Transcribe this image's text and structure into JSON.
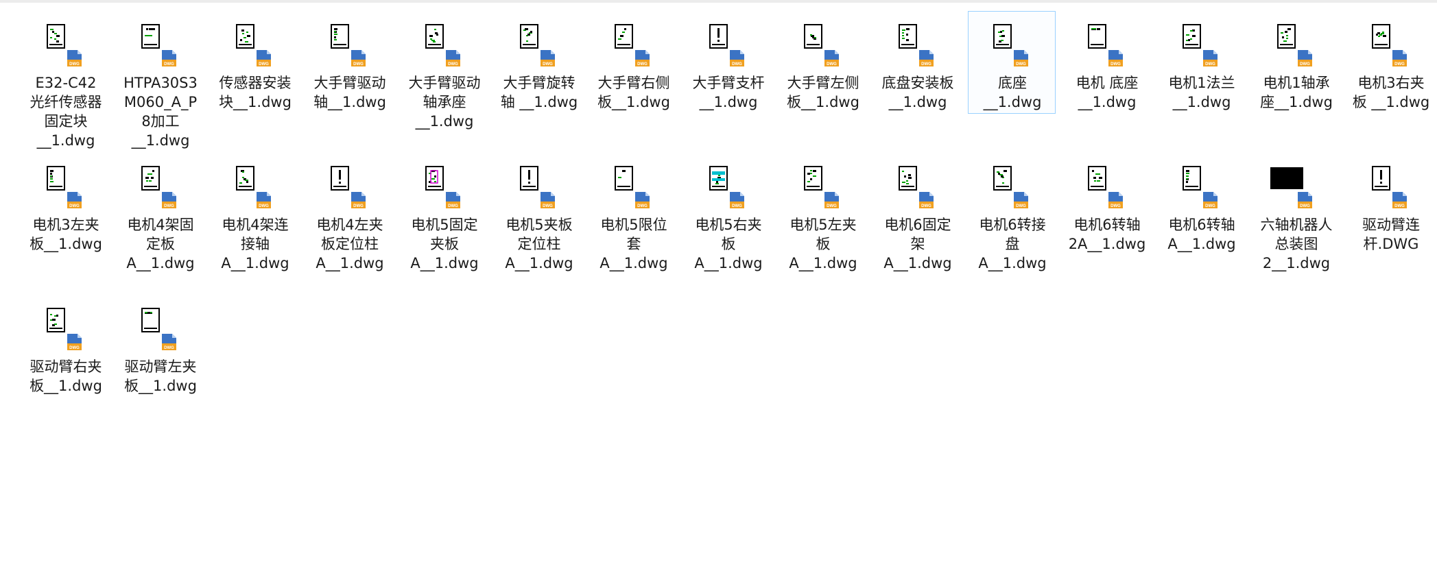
{
  "files": [
    {
      "label": "E32-C42\n光纤传感器\n固定块\n__1.dwg",
      "icon": "dwg-file-icon",
      "thumb": "drawing",
      "selected": false
    },
    {
      "label": "HTPA30S3\nM060_A_P\n8加工\n__1.dwg",
      "icon": "dwg-file-icon",
      "thumb": "drawing",
      "selected": false
    },
    {
      "label": "传感器安装\n块__1.dwg",
      "icon": "dwg-file-icon",
      "thumb": "drawing",
      "selected": false
    },
    {
      "label": "大手臂驱动\n轴__1.dwg",
      "icon": "dwg-file-icon",
      "thumb": "drawing",
      "selected": false
    },
    {
      "label": "大手臂驱动\n轴承座\n__1.dwg",
      "icon": "dwg-file-icon",
      "thumb": "drawing",
      "selected": false
    },
    {
      "label": "大手臂旋转\n轴 __1.dwg",
      "icon": "dwg-file-icon",
      "thumb": "drawing",
      "selected": false
    },
    {
      "label": "大手臂右侧\n板__1.dwg",
      "icon": "dwg-file-icon",
      "thumb": "drawing",
      "selected": false
    },
    {
      "label": "大手臂支杆\n__1.dwg",
      "icon": "dwg-file-icon",
      "thumb": "line",
      "selected": false
    },
    {
      "label": "大手臂左侧\n板__1.dwg",
      "icon": "dwg-file-icon",
      "thumb": "drawing",
      "selected": false
    },
    {
      "label": "底盘安装板\n__1.dwg",
      "icon": "dwg-file-icon",
      "thumb": "drawing",
      "selected": false
    },
    {
      "label": "底座\n__1.dwg",
      "icon": "dwg-file-icon",
      "thumb": "drawing",
      "selected": true
    },
    {
      "label": "电机 底座\n__1.dwg",
      "icon": "dwg-file-icon",
      "thumb": "drawing",
      "selected": false
    },
    {
      "label": "电机1法兰\n__1.dwg",
      "icon": "dwg-file-icon",
      "thumb": "drawing",
      "selected": false
    },
    {
      "label": "电机1轴承\n座__1.dwg",
      "icon": "dwg-file-icon",
      "thumb": "drawing",
      "selected": false
    },
    {
      "label": "电机3右夹\n板 __1.dwg",
      "icon": "dwg-file-icon",
      "thumb": "drawing",
      "selected": false
    },
    {
      "label": "电机3左夹\n板__1.dwg",
      "icon": "dwg-file-icon",
      "thumb": "drawing",
      "selected": false
    },
    {
      "label": "电机4架固\n定板\nA__1.dwg",
      "icon": "dwg-file-icon",
      "thumb": "drawing",
      "selected": false
    },
    {
      "label": "电机4架连\n接轴\nA__1.dwg",
      "icon": "dwg-file-icon",
      "thumb": "drawing",
      "selected": false
    },
    {
      "label": "电机4左夹\n板定位柱\nA__1.dwg",
      "icon": "dwg-file-icon",
      "thumb": "line",
      "selected": false
    },
    {
      "label": "电机5固定\n夹板\nA__1.dwg",
      "icon": "dwg-file-icon",
      "thumb": "magenta",
      "selected": false
    },
    {
      "label": "电机5夹板\n定位柱\nA__1.dwg",
      "icon": "dwg-file-icon",
      "thumb": "line",
      "selected": false
    },
    {
      "label": "电机5限位\n套\nA__1.dwg",
      "icon": "dwg-file-icon",
      "thumb": "drawing",
      "selected": false
    },
    {
      "label": "电机5右夹\n板\nA__1.dwg",
      "icon": "dwg-file-icon",
      "thumb": "cyan",
      "selected": false
    },
    {
      "label": "电机5左夹\n板\nA__1.dwg",
      "icon": "dwg-file-icon",
      "thumb": "drawing",
      "selected": false
    },
    {
      "label": "电机6固定\n架\nA__1.dwg",
      "icon": "dwg-file-icon",
      "thumb": "drawing",
      "selected": false
    },
    {
      "label": "电机6转接\n盘\nA__1.dwg",
      "icon": "dwg-file-icon",
      "thumb": "drawing",
      "selected": false
    },
    {
      "label": "电机6转轴\n2A__1.dwg",
      "icon": "dwg-file-icon",
      "thumb": "drawing",
      "selected": false
    },
    {
      "label": "电机6转轴\nA__1.dwg",
      "icon": "dwg-file-icon",
      "thumb": "drawing",
      "selected": false
    },
    {
      "label": "六轴机器人\n总装图\n2__1.dwg",
      "icon": "dwg-file-icon",
      "thumb": "black",
      "selected": false
    },
    {
      "label": "驱动臂连\n杆.DWG",
      "icon": "dwg-file-icon",
      "thumb": "line",
      "selected": false
    },
    {
      "label": "驱动臂右夹\n板__1.dwg",
      "icon": "dwg-file-icon",
      "thumb": "drawing",
      "selected": false
    },
    {
      "label": "驱动臂左夹\n板__1.dwg",
      "icon": "dwg-file-icon",
      "thumb": "drawing",
      "selected": false
    }
  ],
  "colors": {
    "selection_border": "#99d1ff",
    "badge_blue": "#3b73c4",
    "badge_orange": "#f0a020",
    "cad_green": "#00a000"
  }
}
